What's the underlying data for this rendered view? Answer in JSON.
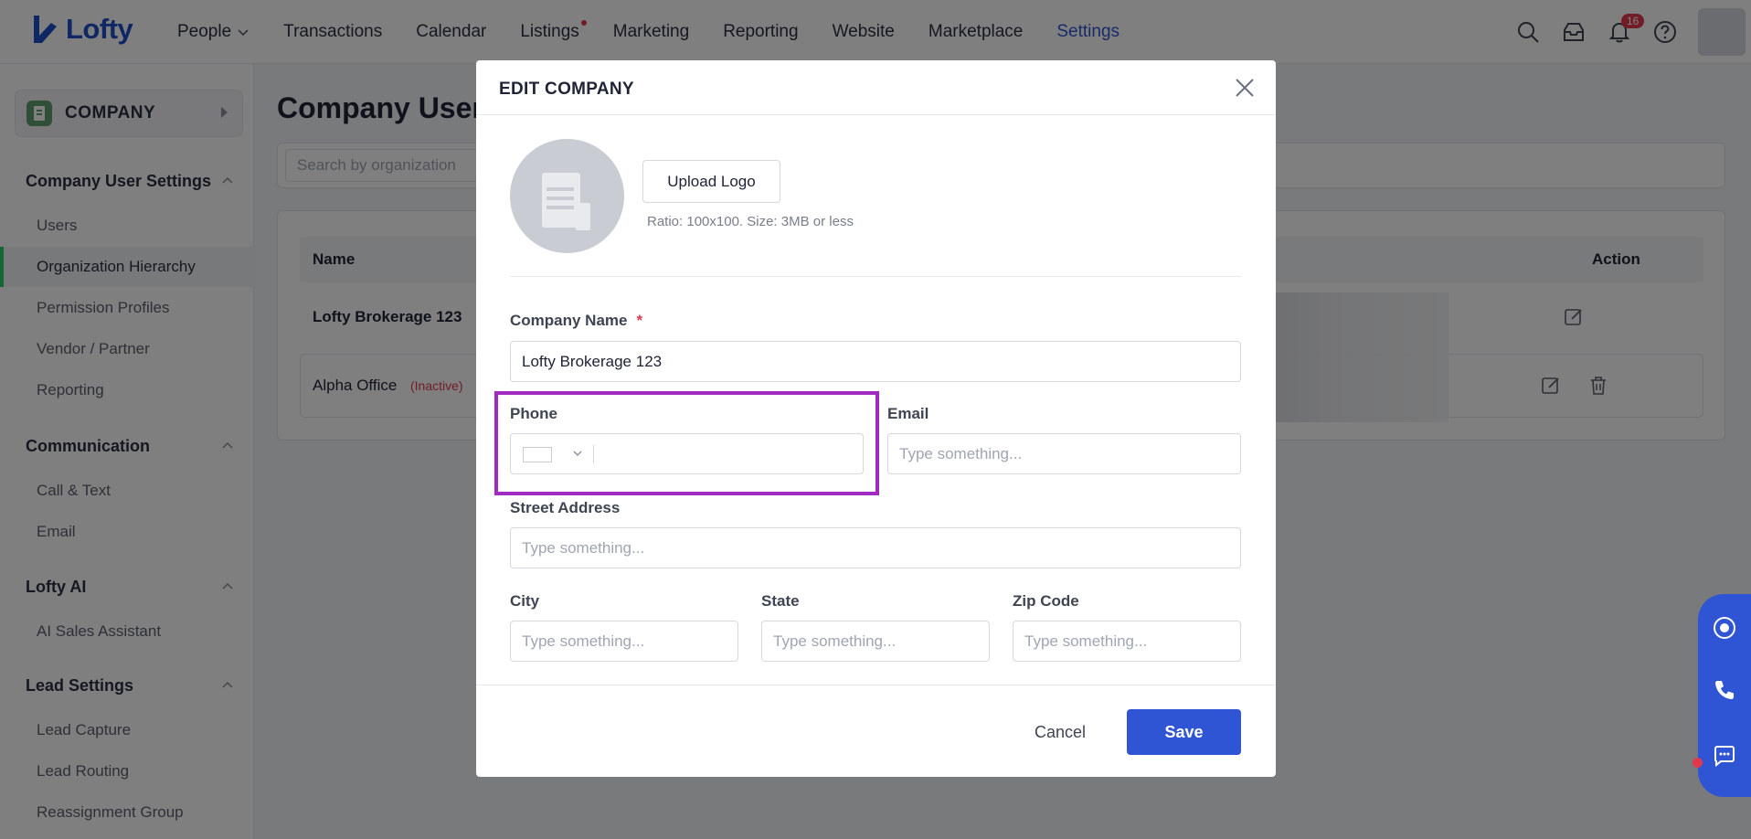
{
  "app": {
    "name": "Lofty",
    "brand_color": "#2f55d4"
  },
  "nav": {
    "items": [
      {
        "label": "People"
      },
      {
        "label": "Transactions"
      },
      {
        "label": "Calendar"
      },
      {
        "label": "Listings"
      },
      {
        "label": "Marketing"
      },
      {
        "label": "Reporting"
      },
      {
        "label": "Website"
      },
      {
        "label": "Marketplace"
      },
      {
        "label": "Settings"
      }
    ],
    "notification_count": "16"
  },
  "sidebar": {
    "company_label": "COMPANY",
    "sections": [
      {
        "title": "Company User Settings",
        "items": [
          "Users",
          "Organization Hierarchy",
          "Permission Profiles",
          "Vendor / Partner",
          "Reporting"
        ]
      },
      {
        "title": "Communication",
        "items": [
          "Call & Text",
          "Email"
        ]
      },
      {
        "title": "Lofty AI",
        "items": [
          "AI Sales Assistant"
        ]
      },
      {
        "title": "Lead Settings",
        "items": [
          "Lead Capture",
          "Lead Routing",
          "Reassignment Group"
        ]
      }
    ],
    "active_item": "Organization Hierarchy"
  },
  "main": {
    "title": "Company User",
    "search_placeholder": "Search by organization",
    "table": {
      "col_name": "Name",
      "col_action": "Action",
      "rows": [
        {
          "name": "Lofty Brokerage 123"
        },
        {
          "name": "Alpha Office",
          "status": "(Inactive)"
        }
      ]
    }
  },
  "modal": {
    "title": "EDIT COMPANY",
    "upload_label": "Upload Logo",
    "ratio_note": "Ratio: 100x100. Size: 3MB or less",
    "company_name_label": "Company Name",
    "required_mark": "*",
    "company_name_value": "Lofty Brokerage 123",
    "phone_label": "Phone",
    "email_label": "Email",
    "street_label": "Street Address",
    "city_label": "City",
    "state_label": "State",
    "zip_label": "Zip Code",
    "placeholder": "Type something...",
    "cancel_label": "Cancel",
    "save_label": "Save"
  },
  "icons": [
    "search-icon",
    "inbox-icon",
    "bell-icon",
    "help-icon",
    "chevron-down-icon",
    "close-icon",
    "edit-icon",
    "trash-icon",
    "phone-icon",
    "chat-icon",
    "assistant-icon"
  ]
}
